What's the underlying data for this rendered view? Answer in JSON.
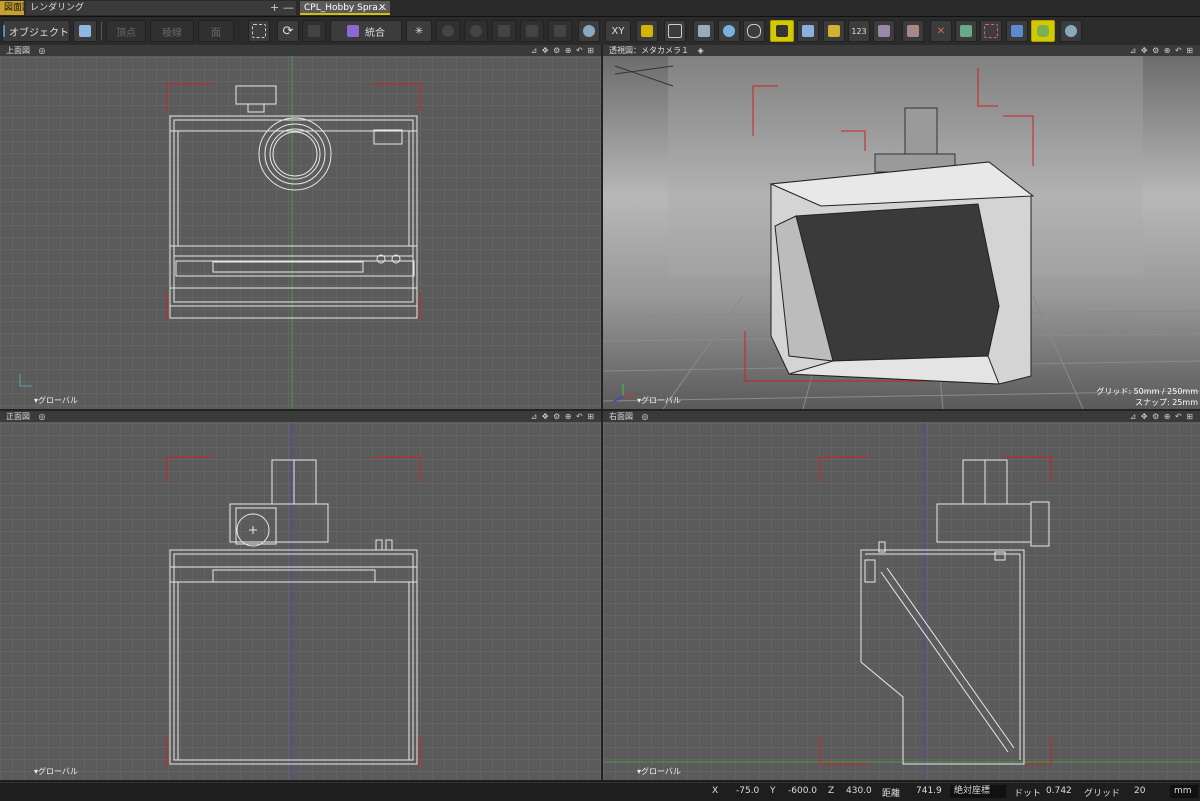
{
  "tabs": {
    "tab1": "図面図",
    "tab2": "レンダリング",
    "tab3": "CPL_Hobby Spra…",
    "add": "+",
    "minimize": "—",
    "close": "✕"
  },
  "toolbar": {
    "object_mode": "オブジェクト",
    "vertex": "頂点",
    "edge": "稜線",
    "face": "面",
    "merge": "統合",
    "xy": "XY"
  },
  "viewports": {
    "top": {
      "title": "上面図",
      "footer": "グローバル"
    },
    "perspective": {
      "title": "透視図：メタカメラ１",
      "footer": "グローバル",
      "grid_info": "グリッド: 50mm / 250mm",
      "snap_info": "スナップ: 25mm"
    },
    "front": {
      "title": "正面図",
      "footer": "グローバル"
    },
    "right": {
      "title": "右面図",
      "footer": "グローバル"
    }
  },
  "status": {
    "x_label": "X",
    "x_value": "-75.0",
    "y_label": "Y",
    "y_value": "-600.0",
    "z_label": "Z",
    "z_value": "430.0",
    "dist_label": "距離",
    "dist_value": "741.9",
    "coord_mode": "絶対座標",
    "dot_label": "ドット",
    "dot_value": "0.742",
    "grid_label": "グリッド",
    "grid_value": "20",
    "unit": "mm"
  },
  "colors": {
    "accent": "#d4c800",
    "viewport_bg": "#5b5b5b",
    "wire": "#e8e8e8",
    "bound_marker": "#d02020"
  }
}
